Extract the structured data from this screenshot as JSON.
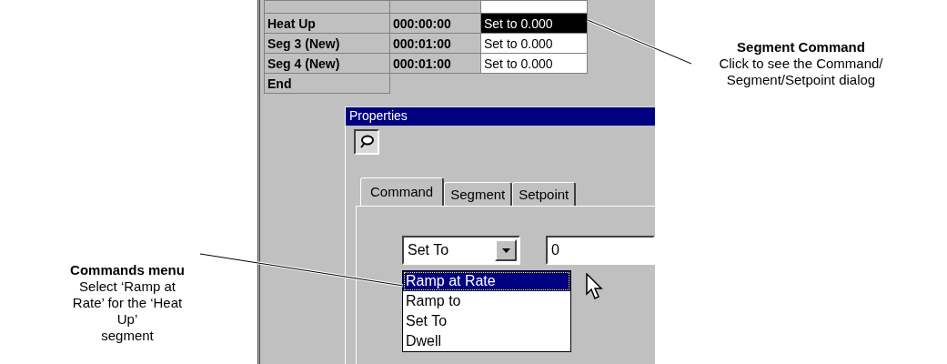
{
  "table": {
    "rows": [
      {
        "name": "Heat Up",
        "time": "000:00:00",
        "command": "Set to 0.000",
        "selected": true
      },
      {
        "name": "Seg 3 (New)",
        "time": "000:01:00",
        "command": "Set to 0.000",
        "selected": false
      },
      {
        "name": "Seg 4 (New)",
        "time": "000:01:00",
        "command": "Set to 0.000",
        "selected": false
      },
      {
        "name": "End"
      }
    ]
  },
  "dialog": {
    "title": "Properties",
    "tabs": [
      {
        "label": "Command",
        "selected": true
      },
      {
        "label": "Segment",
        "selected": false
      },
      {
        "label": "Setpoint",
        "selected": false
      }
    ],
    "command_select": {
      "value": "Set To"
    },
    "value_field": {
      "value": "0"
    },
    "dropdown_list": [
      {
        "label": "Ramp at Rate",
        "selected": true
      },
      {
        "label": "Ramp to",
        "selected": false
      },
      {
        "label": "Set To",
        "selected": false
      },
      {
        "label": "Dwell",
        "selected": false
      }
    ]
  },
  "left_note": {
    "title": "Commands menu",
    "lines": [
      "Select ‘Ramp at Rate’ for the ‘Heat Up’",
      "segment"
    ]
  },
  "right_note": {
    "title": "Segment Command",
    "lines": [
      "Click to see the Command/ Segment/Setpoint dialog"
    ]
  }
}
